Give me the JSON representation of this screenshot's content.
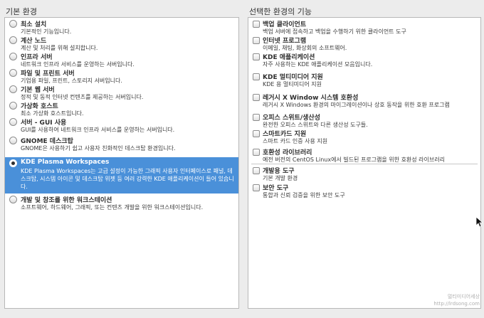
{
  "left": {
    "title": "기본 환경",
    "items": [
      {
        "title": "최소 설치",
        "desc": "기본적인 기능입니다."
      },
      {
        "title": "계산 노드",
        "desc": "계산 및 처리를 위해 설치합니다."
      },
      {
        "title": "인프라 서버",
        "desc": "네트워크 인프라 서비스를 운영하는 서버입니다."
      },
      {
        "title": "파일 및 프린트 서버",
        "desc": "기업용 파일, 프린트, 스토리지 서버입니다."
      },
      {
        "title": "기본 웹 서버",
        "desc": "정적 및 동적 인터넷 컨텐츠를 제공하는 서버입니다."
      },
      {
        "title": "가상화 호스트",
        "desc": "최소 가상화 호스트입니다."
      },
      {
        "title": "서버 - GUI 사용",
        "desc": "GUI를 사용하여 네트워크 인프라 서비스를 운영하는 서버입니다."
      },
      {
        "title": "GNOME 데스크탑",
        "desc": "GNOME은 사용하기 쉽고 사용자 친화적인 데스크탑 환경입니다."
      },
      {
        "title": "KDE Plasma Workspaces",
        "desc": "KDE Plasma Workspaces는 고급 설정이 가능한 그래픽 사용자 인터페이스로 패널, 데스크탑, 시스템 아이콘 및 데스크탑 위젯 등 여러 강력한 KDE 애플리케이션이 들어 있습니다.",
        "selected": true
      },
      {
        "title": "개발 및 창조를 위한 워크스테이션",
        "desc": "소프트웨어, 하드웨어, 그래픽, 또는 컨텐츠 개발을 위한 워크스테이션입니다."
      }
    ]
  },
  "right": {
    "title": "선택한 환경의 기능",
    "items": [
      {
        "title": "백업 클라이언트",
        "desc": "백업 서버에 접속하고 백업을 수행하기 위한 클라이언트 도구"
      },
      {
        "title": "인터넷 프로그램",
        "desc": "이메일, 채팅, 화상회의 소프트웨어."
      },
      {
        "title": "KDE 애플리케이션",
        "desc": "자주 사용하는 KDE 애플리케이션 모음입니다."
      },
      {
        "title": "KDE 멀티미디어 지원",
        "desc": "KDE 용 멀티미디어 지원"
      },
      {
        "title": "레거시 X Window 시스템 호환성",
        "desc": "레거시 X Windows 환경의 마이그레이션이나 상호 동작을 위한 호환 프로그램"
      },
      {
        "title": "오피스 스위트/생산성",
        "desc": "완전한 오피스 스위트와 다른 생산성 도구들."
      },
      {
        "title": "스마트카드 지원",
        "desc": "스마트 카드 인증 사용 지원"
      },
      {
        "title": "호환성 라이브러리",
        "desc": "예전 버전의 CentOS Linux에서 빌드된 프로그램을 위한 호환성 라이브러리"
      },
      {
        "title": "개발용 도구",
        "desc": "기본 개발 환경"
      },
      {
        "title": "보안 도구",
        "desc": "통합과 신뢰 검증을 위한 보안 도구"
      }
    ]
  },
  "colors": {
    "selection": "#4a90d9",
    "panel_bg": "#ffffff",
    "window_bg": "#ececec"
  },
  "watermark": {
    "line1": "멀티미디어세상",
    "line2": "http://lrdsong.com"
  }
}
